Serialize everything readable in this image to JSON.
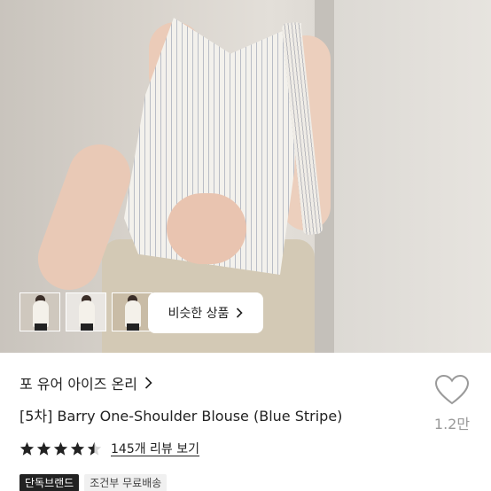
{
  "product": {
    "similar_label": "비슷한 상품",
    "brand": "포 유어 아이즈 온리",
    "title": "[5차] Barry One-Shoulder Blouse (Blue Stripe)",
    "likes": "1.2만",
    "rating": 4.5,
    "reviews_link": "145개 리뷰 보기",
    "badges": [
      "단독브랜드",
      "조건부 무료배송"
    ]
  },
  "icons": {
    "similar_chevron": "chevron-right-icon",
    "brand_chevron": "chevron-right-icon",
    "like": "heart-outline-icon",
    "star": "star-icon"
  },
  "colors": {
    "text": "#222222",
    "muted": "#9a9a9a",
    "badge_dark": "#222222",
    "badge_light": "#f0f0f0"
  }
}
